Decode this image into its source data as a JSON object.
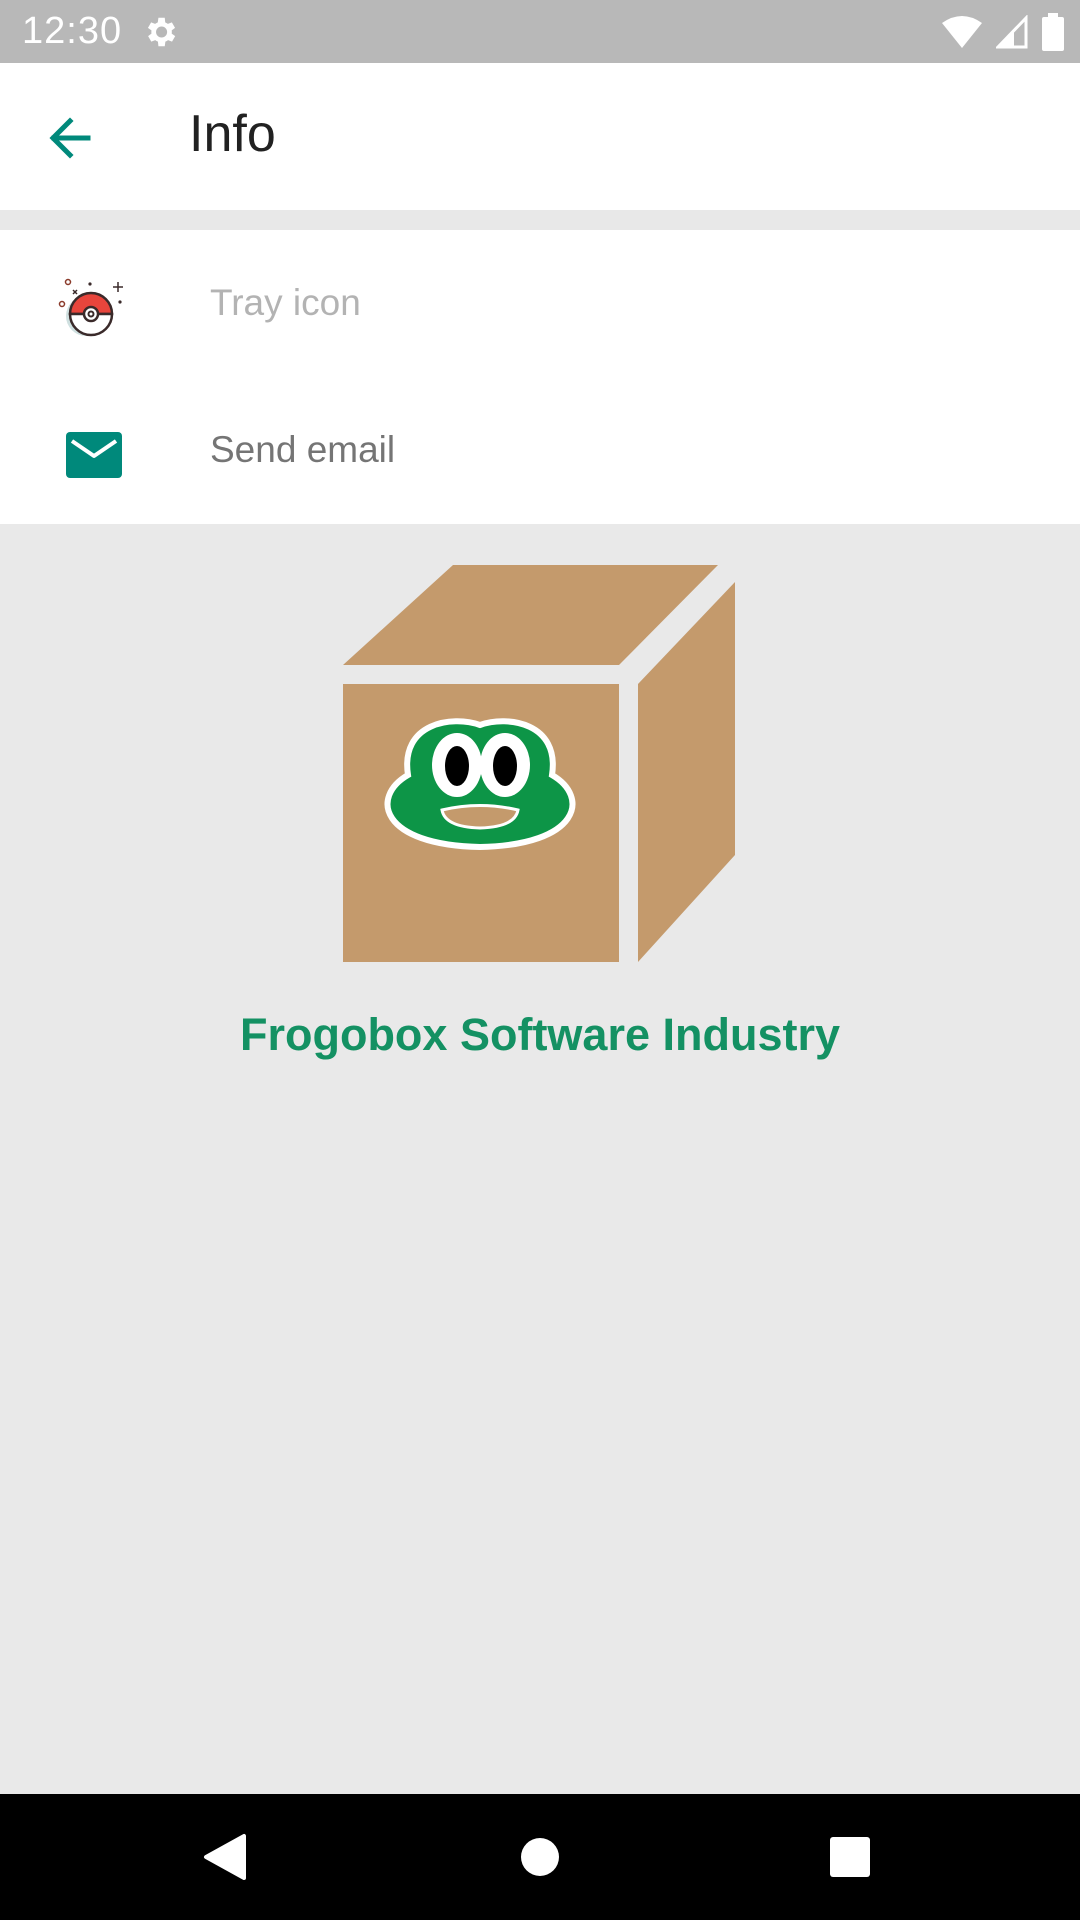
{
  "status_bar": {
    "time": "12:30",
    "icons": [
      "gear-icon",
      "wifi-icon",
      "signal-icon",
      "battery-icon"
    ]
  },
  "app_bar": {
    "title": "Info",
    "back_icon": "arrow-left-icon"
  },
  "list": {
    "items": [
      {
        "label": "Tray icon",
        "icon": "pokeball-icon",
        "enabled": false
      },
      {
        "label": "Send email",
        "icon": "email-icon",
        "enabled": true
      }
    ]
  },
  "about": {
    "logo": "frogobox-logo",
    "company_name": "Frogobox Software Industry"
  },
  "nav_bar": {
    "icons": [
      "nav-back-icon",
      "nav-home-icon",
      "nav-recents-icon"
    ]
  },
  "colors": {
    "accent": "#149163",
    "teal": "#00897b",
    "box": "#c49a6c",
    "frog": "#0d9547",
    "background": "#e9e9e9"
  }
}
